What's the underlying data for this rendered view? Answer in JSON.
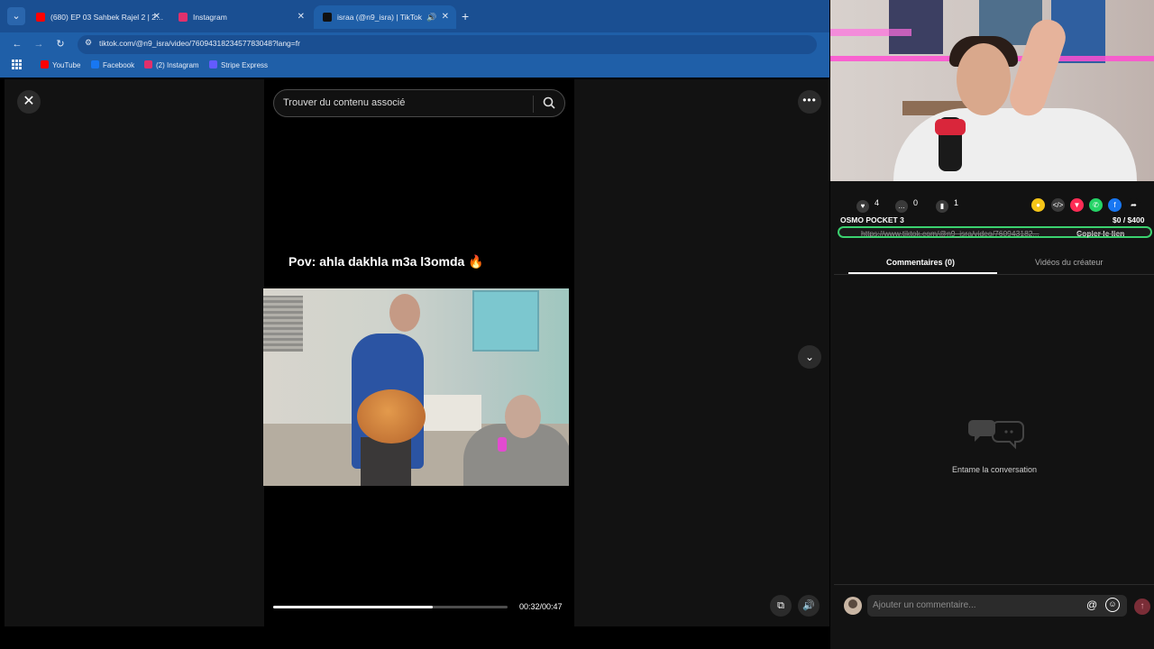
{
  "browser": {
    "tabs": [
      {
        "label": "(680) EP 03 Sahbek Rajel 2 | 2…",
        "icon": "youtube-icon",
        "color": "#ff0000"
      },
      {
        "label": "Instagram",
        "icon": "instagram-icon",
        "color": "#e1306c"
      },
      {
        "label": "israa (@n9_isra) | TikTok",
        "icon": "tiktok-icon",
        "color": "#111111"
      }
    ],
    "url": "tiktok.com/@n9_isra/video/7609431823457783048?lang=fr",
    "bookmarks": [
      {
        "label": "YouTube",
        "icon": "youtube-icon",
        "color": "#ff0000"
      },
      {
        "label": "Facebook",
        "icon": "facebook-icon",
        "color": "#1877f2"
      },
      {
        "label": "(2) Instagram",
        "icon": "instagram-icon",
        "color": "#e1306c"
      },
      {
        "label": "Stripe Express",
        "icon": "stripe-icon",
        "color": "#635bff"
      }
    ]
  },
  "player": {
    "search_placeholder": "Trouver du contenu associé",
    "caption": "Pov: ahla dakhla m3a l3omda",
    "caption_emoji": "🔥",
    "time": "00:32/00:47",
    "progress_fraction": 0.68
  },
  "sidebar": {
    "stats": {
      "likes": "4",
      "comments": "0",
      "saves": "1"
    },
    "overlay_title": "OSMO POCKET 3",
    "overlay_money": "$0  / $400",
    "link_url": "https://www.tiktok.com/@n9_isra/video/760943182...",
    "copy_link": "Copier le lien",
    "tabs": [
      "Commentaires (0)",
      "Vidéos du créateur"
    ],
    "empty_text": "Entame la conversation",
    "comment_placeholder": "Ajouter un commentaire...",
    "share_icons": [
      {
        "name": "coin-icon",
        "color": "#f5c518"
      },
      {
        "name": "embed-icon",
        "color": "#3a3a3a"
      },
      {
        "name": "send-icon",
        "color": "#fe2c55"
      },
      {
        "name": "whatsapp-icon",
        "color": "#25d366"
      },
      {
        "name": "facebook-icon",
        "color": "#1877f2"
      },
      {
        "name": "share-arrow-icon",
        "color": "#121212"
      }
    ]
  }
}
